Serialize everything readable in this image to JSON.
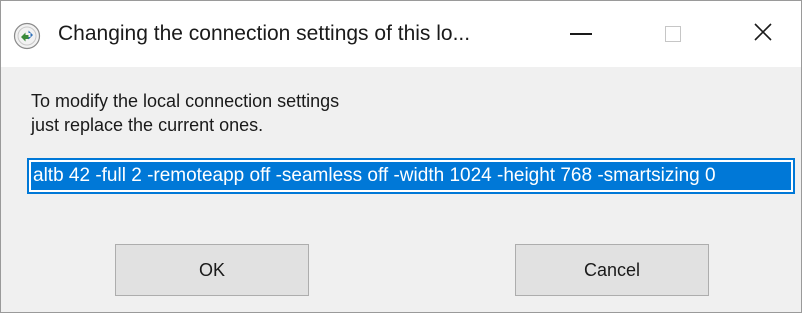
{
  "window": {
    "title": "Changing the connection settings of this lo...",
    "icon": "remote-connection-icon",
    "controls": {
      "minimize": "minimize-icon",
      "maximize": "maximize-icon",
      "close": "close-icon"
    }
  },
  "message": {
    "line1": "To modify the local connection settings",
    "line2": "just replace the current ones."
  },
  "settings_field": {
    "value": "altb 42 -full 2 -remoteapp off -seamless off -width 1024 -height 768 -smartsizing 0"
  },
  "buttons": {
    "ok": "OK",
    "cancel": "Cancel"
  },
  "colors": {
    "selection": "#0078d7",
    "button_bg": "#e1e1e1",
    "dialog_bg": "#f0f0f0"
  }
}
